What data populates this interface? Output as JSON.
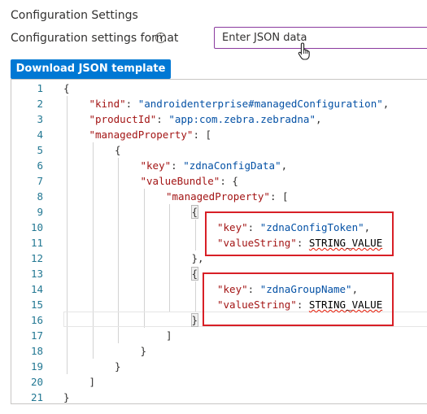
{
  "section_title": "Configuration Settings",
  "format_label": "Configuration settings format",
  "info_icon_glyph": "i",
  "format_select_value": "Enter JSON data",
  "download_button_label": "Download JSON template",
  "editor": {
    "lines": [
      {
        "num": "1",
        "indent": 0,
        "tokens": [
          {
            "t": "p",
            "v": "{"
          }
        ]
      },
      {
        "num": "2",
        "indent": 1,
        "tokens": [
          {
            "t": "k",
            "v": "\"kind\""
          },
          {
            "t": "p",
            "v": ": "
          },
          {
            "t": "s",
            "v": "\"androidenterprise#managedConfiguration\""
          },
          {
            "t": "p",
            "v": ","
          }
        ]
      },
      {
        "num": "3",
        "indent": 1,
        "tokens": [
          {
            "t": "k",
            "v": "\"productId\""
          },
          {
            "t": "p",
            "v": ": "
          },
          {
            "t": "s",
            "v": "\"app:com.zebra.zebradna\""
          },
          {
            "t": "p",
            "v": ","
          }
        ]
      },
      {
        "num": "4",
        "indent": 1,
        "tokens": [
          {
            "t": "k",
            "v": "\"managedProperty\""
          },
          {
            "t": "p",
            "v": ": ["
          }
        ]
      },
      {
        "num": "5",
        "indent": 2,
        "tokens": [
          {
            "t": "p",
            "v": "{"
          }
        ]
      },
      {
        "num": "6",
        "indent": 3,
        "tokens": [
          {
            "t": "k",
            "v": "\"key\""
          },
          {
            "t": "p",
            "v": ": "
          },
          {
            "t": "s",
            "v": "\"zdnaConfigData\""
          },
          {
            "t": "p",
            "v": ","
          }
        ]
      },
      {
        "num": "7",
        "indent": 3,
        "tokens": [
          {
            "t": "k",
            "v": "\"valueBundle\""
          },
          {
            "t": "p",
            "v": ": {"
          }
        ]
      },
      {
        "num": "8",
        "indent": 4,
        "tokens": [
          {
            "t": "k",
            "v": "\"managedProperty\""
          },
          {
            "t": "p",
            "v": ": ["
          }
        ]
      },
      {
        "num": "9",
        "indent": 5,
        "tokens": [
          {
            "t": "h",
            "v": "{"
          }
        ]
      },
      {
        "num": "10",
        "indent": 6,
        "tokens": [
          {
            "t": "k",
            "v": "\"key\""
          },
          {
            "t": "p",
            "v": ": "
          },
          {
            "t": "s",
            "v": "\"zdnaConfigToken\""
          },
          {
            "t": "p",
            "v": ","
          }
        ]
      },
      {
        "num": "11",
        "indent": 6,
        "tokens": [
          {
            "t": "k",
            "v": "\"valueString\""
          },
          {
            "t": "p",
            "v": ": "
          },
          {
            "t": "b",
            "v": "STRING_VALUE"
          }
        ]
      },
      {
        "num": "12",
        "indent": 5,
        "tokens": [
          {
            "t": "p",
            "v": "},"
          }
        ]
      },
      {
        "num": "13",
        "indent": 5,
        "tokens": [
          {
            "t": "h",
            "v": "{"
          }
        ]
      },
      {
        "num": "14",
        "indent": 6,
        "tokens": [
          {
            "t": "k",
            "v": "\"key\""
          },
          {
            "t": "p",
            "v": ": "
          },
          {
            "t": "s",
            "v": "\"zdnaGroupName\""
          },
          {
            "t": "p",
            "v": ","
          }
        ]
      },
      {
        "num": "15",
        "indent": 6,
        "tokens": [
          {
            "t": "k",
            "v": "\"valueString\""
          },
          {
            "t": "p",
            "v": ": "
          },
          {
            "t": "b",
            "v": "STRING_VALUE"
          }
        ]
      },
      {
        "num": "16",
        "indent": 5,
        "tokens": [
          {
            "t": "h",
            "v": "}"
          }
        ]
      },
      {
        "num": "17",
        "indent": 4,
        "tokens": [
          {
            "t": "p",
            "v": "]"
          }
        ]
      },
      {
        "num": "18",
        "indent": 3,
        "tokens": [
          {
            "t": "p",
            "v": "}"
          }
        ]
      },
      {
        "num": "19",
        "indent": 2,
        "tokens": [
          {
            "t": "p",
            "v": "}"
          }
        ]
      },
      {
        "num": "20",
        "indent": 1,
        "tokens": [
          {
            "t": "p",
            "v": "]"
          }
        ]
      },
      {
        "num": "21",
        "indent": 0,
        "tokens": [
          {
            "t": "p",
            "v": "}"
          }
        ]
      }
    ]
  },
  "colors": {
    "accent": "#0078d4",
    "highlight_box": "#d81f26",
    "json_key": "#a31515",
    "json_string": "#0451a5",
    "line_number": "#237893"
  },
  "icons": {
    "info": "info-icon",
    "cursor": "hand-cursor-icon"
  }
}
